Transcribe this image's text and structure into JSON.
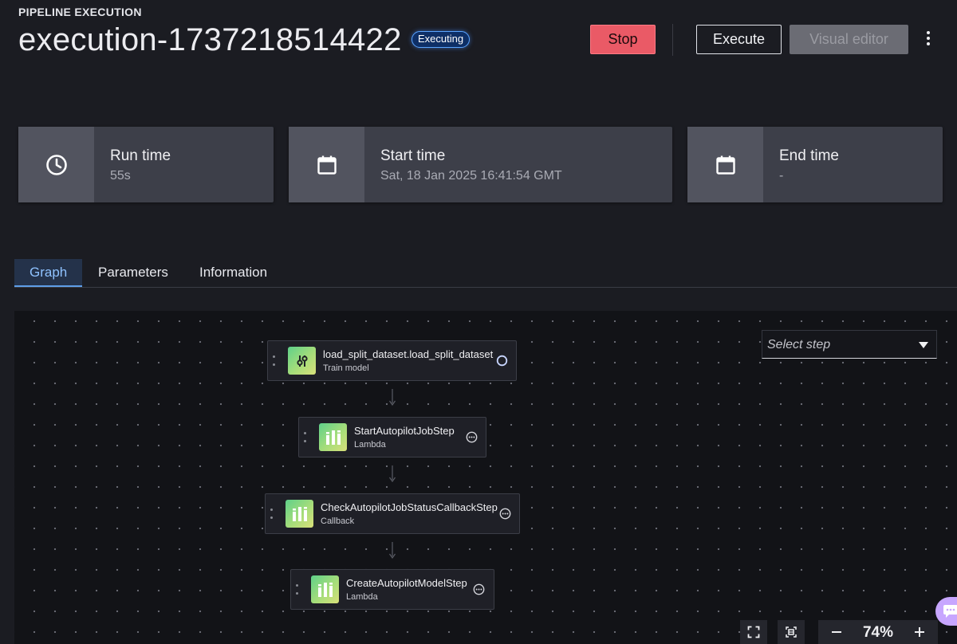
{
  "header": {
    "eyebrow": "PIPELINE EXECUTION",
    "title": "execution-1737218514422",
    "status_badge": "Executing",
    "buttons": {
      "stop": "Stop",
      "execute": "Execute",
      "visual_editor": "Visual editor"
    },
    "more_icon": "kebab-vertical-icon"
  },
  "stats": [
    {
      "label": "Run time",
      "value": "55s",
      "icon": "clock-icon"
    },
    {
      "label": "Start time",
      "value": "Sat, 18 Jan 2025 16:41:54 GMT",
      "icon": "calendar-icon"
    },
    {
      "label": "End time",
      "value": "-",
      "icon": "calendar-icon"
    }
  ],
  "tabs": [
    {
      "label": "Graph",
      "active": true
    },
    {
      "label": "Parameters",
      "active": false
    },
    {
      "label": "Information",
      "active": false
    }
  ],
  "graph": {
    "select_step": {
      "placeholder": "Select step"
    },
    "nodes": [
      {
        "title": "load_split_dataset.load_split_dataset",
        "subtitle": "Train model",
        "status": "running",
        "icon": "sliders-icon"
      },
      {
        "title": "StartAutopilotJobStep",
        "subtitle": "Lambda",
        "status": "pending",
        "icon": "lambda-step-icon"
      },
      {
        "title": "CheckAutopilotJobStatusCallbackStep",
        "subtitle": "Callback",
        "status": "pending",
        "icon": "callback-step-icon"
      },
      {
        "title": "CreateAutopilotModelStep",
        "subtitle": "Lambda",
        "status": "pending",
        "icon": "lambda-step-icon"
      }
    ],
    "controls": {
      "zoom": "74%"
    }
  },
  "colors": {
    "background": "#1b1c22",
    "stop": "#ea5a66",
    "active_tab": "#8fc2ff",
    "badge_border": "#5aa4ff",
    "node_icon_gradient_start": "#5fd08a",
    "node_icon_gradient_end": "#d9e07a"
  }
}
